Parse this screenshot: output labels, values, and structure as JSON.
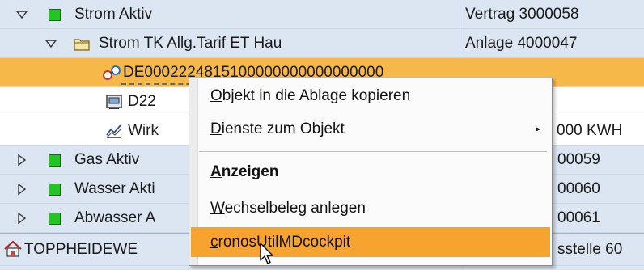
{
  "tree": {
    "rows": [
      {
        "label": "Strom Aktiv",
        "value": "Vertrag 3000058"
      },
      {
        "label": "Strom TK Allg.Tarif ET Hau",
        "value": "Anlage 4000047"
      },
      {
        "label": "DE0002224815100000000000000000",
        "value": ""
      },
      {
        "label": "D22",
        "value": ""
      },
      {
        "label": "Wirk",
        "value": "000 KWH"
      },
      {
        "label": "Gas Aktiv",
        "value": "00059"
      },
      {
        "label": "Wasser Akti",
        "value": "00060"
      },
      {
        "label": "Abwasser A",
        "value": "00061"
      },
      {
        "label": "TOPPHEIDEWE",
        "value": "sstelle 60"
      }
    ],
    "colors": {
      "background": "#dbe6f2",
      "selected": "#f7b84a",
      "active_square": "#22c522"
    }
  },
  "context_menu": {
    "items": {
      "copy": {
        "prefix": "",
        "mnemonic": "O",
        "rest": "bjekt in die Ablage kopieren"
      },
      "services": {
        "prefix": "",
        "mnemonic": "D",
        "rest": "ienste zum Objekt"
      },
      "display": {
        "prefix": "",
        "mnemonic": "A",
        "rest": "nzeigen"
      },
      "create": {
        "prefix": "",
        "mnemonic": "W",
        "rest": "echselbeleg anlegen"
      },
      "cockpit": {
        "prefix": "",
        "mnemonic": "c",
        "rest": "ronosUtilMDcockpit"
      }
    },
    "submenu_arrow": "▸",
    "highlight_color": "#f7a330"
  }
}
